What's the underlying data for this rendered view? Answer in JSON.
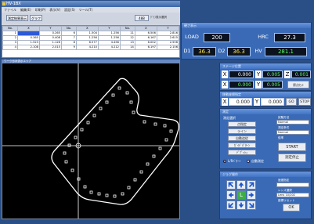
{
  "window": {
    "title": "HV-1BX"
  },
  "menu": [
    "ファイル",
    "編集(E)",
    "印刷(P)",
    "表示(V)",
    "設定(S)",
    "ツール(T)"
  ],
  "toolbar": {
    "tab1": "測定結果表示",
    "tab2": "グラフ",
    "btn_label": "488",
    "extra": "ｸﾞﾗﾌ表示選択"
  },
  "table": {
    "headers": [
      "No.",
      "X",
      "Y",
      "No.",
      "X",
      "Y",
      "No.",
      "X",
      "Y",
      "HV"
    ],
    "rows": [
      [
        "1",
        "",
        "0.265",
        "6",
        "1.504",
        "1.256",
        "11",
        "6.506",
        "2.816"
      ],
      [
        "2",
        "0.365",
        "0.408",
        "7",
        "1.256",
        "1.256",
        "12",
        "6.167",
        "2.615"
      ],
      [
        "3",
        "1.523",
        "1.126",
        "8",
        "6.577",
        "4.456",
        "13",
        "6.002",
        "2.556"
      ],
      [
        "4",
        "2.108",
        "2.015",
        "9",
        "4.210",
        "4.212",
        "14",
        "6.197",
        "2.156"
      ]
    ]
  },
  "canvas": {
    "header": "ワーク形状表示エリア"
  },
  "hardness": {
    "header": "硬さ表示",
    "load_label": "LOAD",
    "load_value": "200",
    "hrc_label": "HRC",
    "hrc_value": "27.3",
    "d1_label": "D1",
    "d1_value": "36.3",
    "d2_label": "D2",
    "d2_value": "36.3",
    "hv_label": "HV",
    "hv_value": "281.1"
  },
  "position": {
    "header": "ステージ位置",
    "x_label": "X",
    "x_value": "0.000",
    "y_label": "Y",
    "y_value": "0.005",
    "z_label": "Z",
    "z_value": "0.001",
    "x2_label": "X",
    "x2_value": "0.000",
    "y2_label": "Y",
    "y2_value": "0.005",
    "set_btn": "原点ｾｯﾄ"
  },
  "move": {
    "header": "移動座標指定",
    "x_label": "X",
    "x_value": "0.000",
    "y_label": "Y",
    "y_value": "0.000",
    "go_btn": "GO",
    "stop_btn": "STOP"
  },
  "measure": {
    "header": "測定",
    "mode_label": "測定選択",
    "options": [
      "点指定",
      "ライン",
      "自動追従",
      "ｶﾞｲﾄﾞﾊﾟﾀｰﾝ",
      "ﾃﾞﾌﾞｯｼｭ"
    ],
    "opt_a": "L/Rﾊﾟﾀｰﾝ",
    "opt_b": "自動測定",
    "test_label": "試験方法",
    "test_value": "Normal",
    "cond_label": "測定条件",
    "cond_value": "Normal",
    "mag_label": "倍率",
    "start_btn": "START",
    "stop_btn": "測定停止"
  },
  "jog": {
    "header": "ジョグ操作",
    "center": "L",
    "speed_label": "速度指定",
    "speed_value": "",
    "lens_label": "レンズ選択",
    "lens_value": "Lens 10/20Σ",
    "reset_label": "座標リセット",
    "ok_btn": "OK"
  }
}
